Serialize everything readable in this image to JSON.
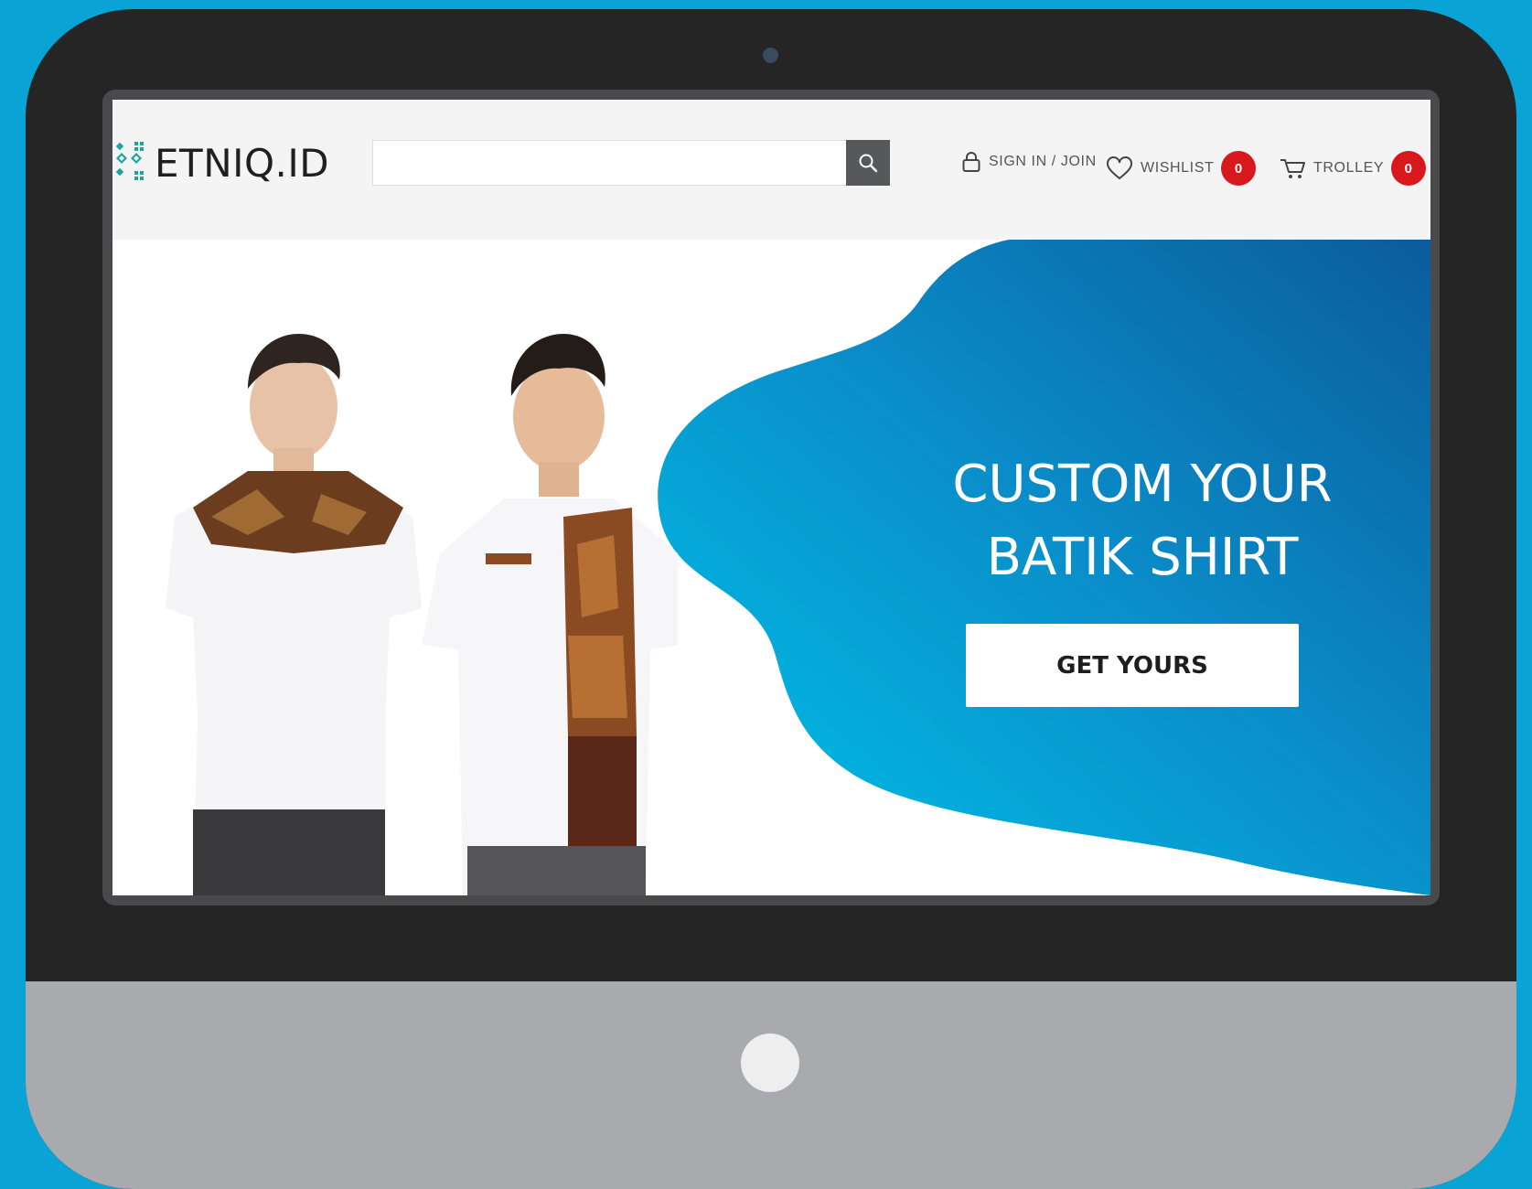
{
  "header": {
    "logo_text": "ETNIQ.ID",
    "search": {
      "value": "",
      "placeholder": ""
    },
    "nav": {
      "signin_label": "SIGN IN / JOIN",
      "wishlist_label": "WISHLIST",
      "wishlist_count": "0",
      "trolley_label": "TROLLEY",
      "trolley_count": "0"
    }
  },
  "hero": {
    "headline_line1": "CUSTOM YOUR",
    "headline_line2": "BATIK SHIRT",
    "cta_label": "GET YOURS"
  },
  "colors": {
    "background": "#0aa3d6",
    "device_frame": "#252525",
    "device_chin": "#a9aaad",
    "badge": "#d9181e",
    "hero_gradient_start": "#00c0e6",
    "hero_gradient_end": "#0a5fa0"
  },
  "icons": [
    "logo-mark-icon",
    "search-icon",
    "user-lock-icon",
    "heart-icon",
    "cart-icon"
  ]
}
